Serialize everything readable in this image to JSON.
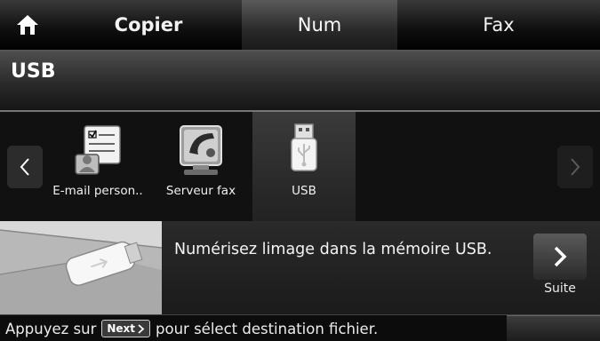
{
  "tabs": [
    {
      "label": "Copier"
    },
    {
      "label": "Num"
    },
    {
      "label": "Fax"
    }
  ],
  "title": "USB",
  "destinations": [
    {
      "label": "E-mail person..",
      "icon": "email-person-icon"
    },
    {
      "label": "Serveur fax",
      "icon": "fax-server-icon"
    },
    {
      "label": "USB",
      "icon": "usb-icon"
    }
  ],
  "info": {
    "message": "Numérisez limage dans la mémoire USB.",
    "suite_label": "Suite"
  },
  "status": {
    "prefix": "Appuyez sur",
    "next_chip": "Next",
    "suffix": "pour sélect destination fichier."
  }
}
